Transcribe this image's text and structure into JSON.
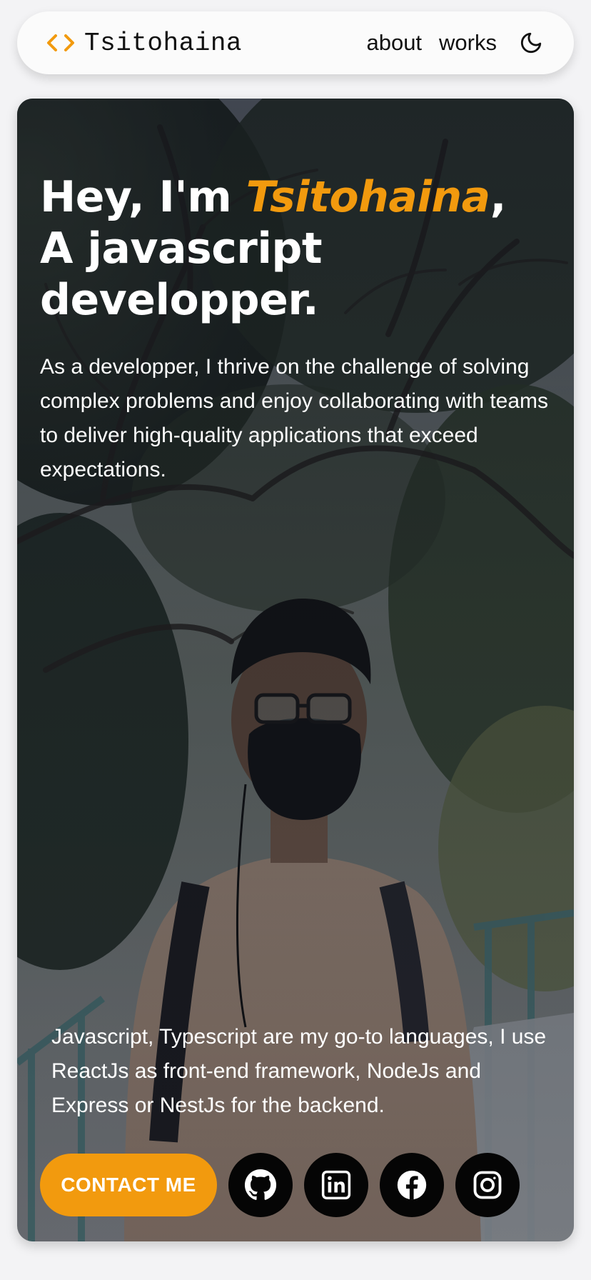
{
  "colors": {
    "accent": "#f29a0e",
    "page_background": "#f3f3f5",
    "navbar_background": "#fbfbfb",
    "text_dark": "#111111",
    "text_light": "#ffffff",
    "social_button": "#050505"
  },
  "navbar": {
    "brand_icon": "code-brackets-icon",
    "brand_name": "Tsitohaina",
    "links": [
      {
        "label": "about"
      },
      {
        "label": "works"
      }
    ],
    "theme_toggle_icon": "moon-icon"
  },
  "hero": {
    "background_image": "photo of a person wearing a black face mask and glasses, standing under trees",
    "headline_prefix": "Hey, I'm ",
    "headline_name": "Tsitohaina",
    "headline_comma": ",",
    "headline_line2": "A javascript",
    "headline_line3": "developper.",
    "intro": "As a developper, I thrive on the challenge of solving complex problems and enjoy collaborating with teams to deliver high-quality applications that exceed expectations.",
    "stack_text": "Javascript, Typescript are my go-to languages, I use ReactJs as front-end framework, NodeJs and Express or NestJs for the backend.",
    "contact_label": "CONTACT ME",
    "socials": [
      {
        "icon": "github-icon"
      },
      {
        "icon": "linkedin-icon"
      },
      {
        "icon": "facebook-icon"
      },
      {
        "icon": "instagram-icon"
      }
    ]
  }
}
